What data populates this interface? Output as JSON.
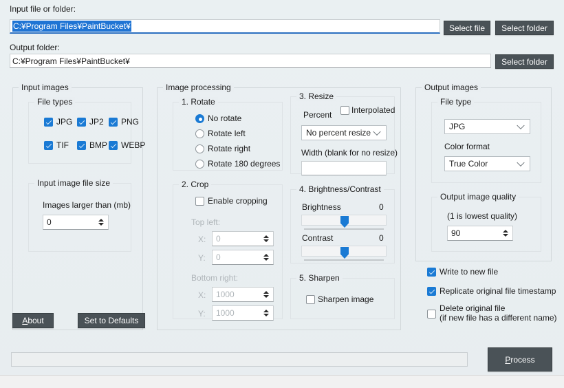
{
  "window": {
    "app_name": "PaintBucket"
  },
  "top": {
    "input_label": "Input file or folder:",
    "input_value": "C:\\Program Files\\PaintBucket\\",
    "input_value_display": "C:¥Program Files¥PaintBucket¥",
    "output_label": "Output folder:",
    "output_value_display": "C:¥Program Files¥PaintBucket¥",
    "select_file_button": "Select file",
    "select_folder_button_1": "Select folder",
    "select_folder_button_2": "Select folder"
  },
  "input_images": {
    "title": "Input images",
    "file_types": {
      "title": "File types",
      "items": [
        {
          "label": "JPG",
          "checked": true
        },
        {
          "label": "JP2",
          "checked": true
        },
        {
          "label": "PNG",
          "checked": true
        },
        {
          "label": "TIF",
          "checked": true
        },
        {
          "label": "BMP",
          "checked": true
        },
        {
          "label": "WEBP",
          "checked": true
        }
      ]
    },
    "file_size": {
      "title": "Input image file size",
      "label": "Images larger than (mb)",
      "value": "0"
    }
  },
  "image_processing": {
    "title": "Image processing",
    "rotate": {
      "title": "1. Rotate",
      "options": [
        {
          "label": "No rotate",
          "selected": true
        },
        {
          "label": "Rotate left",
          "selected": false
        },
        {
          "label": "Rotate right",
          "selected": false
        },
        {
          "label": "Rotate 180 degrees",
          "selected": false
        }
      ]
    },
    "crop": {
      "title": "2. Crop",
      "enable_label": "Enable cropping",
      "enable_checked": false,
      "top_left_label": "Top left:",
      "top_left_x_label": "X:",
      "top_left_x": "0",
      "top_left_y_label": "Y:",
      "top_left_y": "0",
      "bottom_right_label": "Bottom right:",
      "bottom_right_x_label": "X:",
      "bottom_right_x": "1000",
      "bottom_right_y_label": "Y:",
      "bottom_right_y": "1000"
    },
    "resize": {
      "title": "3. Resize",
      "percent_label": "Percent",
      "interpolated_label": "Interpolated",
      "interpolated_checked": false,
      "percent_value": "No percent resize",
      "percent_options": [
        "No percent resize"
      ],
      "width_label": "Width (blank for no resize)",
      "width_value": ""
    },
    "brightness_contrast": {
      "title": "4. Brightness/Contrast",
      "brightness_label": "Brightness",
      "brightness_value": "0",
      "contrast_label": "Contrast",
      "contrast_value": "0"
    },
    "sharpen": {
      "title": "5. Sharpen",
      "sharpen_label": "Sharpen image",
      "sharpen_checked": false
    }
  },
  "output_images": {
    "title": "Output images",
    "file_type": {
      "title": "File type",
      "value": "JPG",
      "options": [
        "JPG"
      ],
      "color_format_label": "Color format",
      "color_format_value": "True Color",
      "color_format_options": [
        "True Color"
      ]
    },
    "quality": {
      "title": "Output image quality",
      "hint": "(1 is lowest quality)",
      "value": "90"
    },
    "options": [
      {
        "label": "Write to new file",
        "checked": true
      },
      {
        "label": "Replicate original file timestamp",
        "checked": true
      },
      {
        "label": "Delete original file",
        "label2": "(if new file has a different name)",
        "checked": false
      }
    ]
  },
  "footer": {
    "about_button_accel": "A",
    "about_button_rest": "bout",
    "defaults_button": "Set to Defaults",
    "process_button_accel": "P",
    "process_button_rest": "rocess",
    "progress_value": 0
  },
  "colors": {
    "accent": "#1a7ad4",
    "selection": "#1f74d4",
    "button_face": "#4a5257",
    "background": "#e9eef1",
    "disabled_text": "#b0b6ba"
  }
}
